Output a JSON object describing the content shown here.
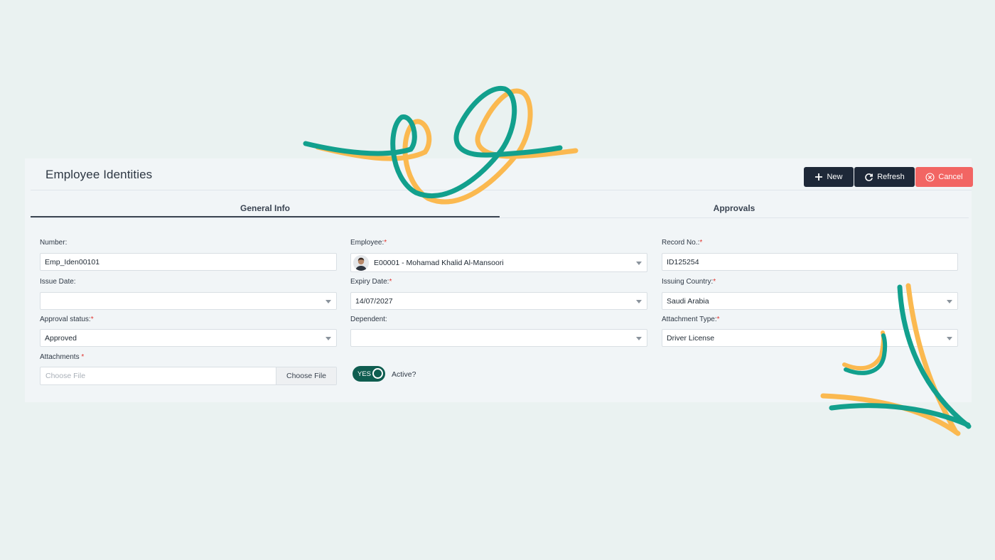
{
  "page": {
    "title": "Employee Identities"
  },
  "toolbar": {
    "new_label": "New",
    "refresh_label": "Refresh",
    "cancel_label": "Cancel"
  },
  "tabs": [
    {
      "label": "General Info",
      "active": true
    },
    {
      "label": "Approvals",
      "active": false
    }
  ],
  "form": {
    "number": {
      "label": "Number:",
      "value": "Emp_Iden00101"
    },
    "employee": {
      "label": "Employee:",
      "required": "*",
      "value": "E00001 - Mohamad Khalid Al-Mansoori"
    },
    "record_no": {
      "label": "Record No.:",
      "required": "*",
      "value": "ID125254"
    },
    "issue_date": {
      "label": "Issue Date:",
      "value": ""
    },
    "expiry_date": {
      "label": "Expiry Date:",
      "required": "*",
      "value": "14/07/2027"
    },
    "issuing_country": {
      "label": "Issuing Country:",
      "required": "*",
      "value": "Saudi Arabia"
    },
    "approval_status": {
      "label": "Approval status:",
      "required": "*",
      "value": "Approved"
    },
    "dependent": {
      "label": "Dependent:",
      "value": ""
    },
    "attachment_type": {
      "label": "Attachment Type:",
      "required": "*",
      "value": "Driver License"
    },
    "attachments": {
      "label": "Attachments",
      "required": "*",
      "placeholder": "Choose File",
      "button_label": "Choose File"
    },
    "active": {
      "toggle_text": "YES",
      "label": "Active?"
    }
  },
  "colors": {
    "dark_button": "#1e2838",
    "cancel_button": "#f26563",
    "toggle": "#0f5d50",
    "deco_teal": "#12a08d",
    "deco_orange": "#fbb950"
  }
}
